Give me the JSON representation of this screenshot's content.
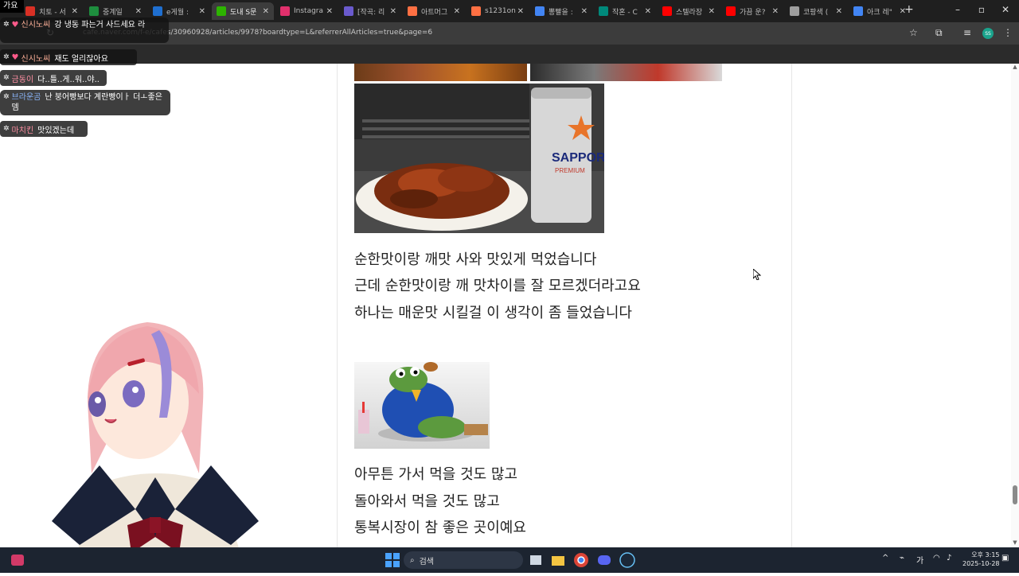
{
  "browser": {
    "tabs": [
      {
        "label": "치토 - 서",
        "favicon_color": "#d93025"
      },
      {
        "label": "중계일",
        "favicon_color": "#1e8e3e"
      },
      {
        "label": "e게월 :",
        "favicon_color": "#1f6fd0"
      },
      {
        "label": "도내 S문",
        "favicon_color": "#2db400",
        "active": true
      },
      {
        "label": "Instagra",
        "favicon_color": "#e1306c"
      },
      {
        "label": "[작곡: 리",
        "favicon_color": "#6a5acd"
      },
      {
        "label": "아트머그",
        "favicon_color": "#ff7043"
      },
      {
        "label": "s1231on",
        "favicon_color": "#ff7043"
      },
      {
        "label": "뽕빨을 :",
        "favicon_color": "#4285f4"
      },
      {
        "label": "작혼 - C",
        "favicon_color": "#00897b"
      },
      {
        "label": "스텔라장",
        "favicon_color": "#ff0000"
      },
      {
        "label": "가끔 운?",
        "favicon_color": "#ff0000"
      },
      {
        "label": "코팡색 (",
        "favicon_color": "#9e9e9e"
      },
      {
        "label": "아크 레\"",
        "favicon_color": "#4285f4"
      }
    ],
    "new_tab_label": "+",
    "url": "cafe.naver.com/f-e/cafes/30960928/articles/9978?boardtype=L&referrerAllArticles=true&page=6",
    "profile_initials": "SS"
  },
  "stream_overlay": {
    "top_label": "가요",
    "chat": [
      {
        "nick": "신시노씨",
        "nick_color": "#ffb199",
        "message": "강 냉동 파는거 사드세요 라",
        "badge": true
      },
      {
        "nick": "신시노씨",
        "nick_color": "#ffb199",
        "message": "재도 얼리잖아요",
        "badge": true
      },
      {
        "nick": "금동이",
        "nick_color": "#ff8fa3",
        "message": "다..틀..게..워..야..",
        "badge": false
      },
      {
        "nick": "브라운곰",
        "nick_color": "#8ab4f8",
        "message": "난 붕어빵보다 계란빵이ㅏ 더ㅗ좋은뎀",
        "badge": false
      },
      {
        "nick": "마치킨",
        "nick_color": "#ff8fa3",
        "message": "맛있겠는데",
        "badge": false
      }
    ]
  },
  "article": {
    "paragraph1": [
      "순한맛이랑 깨맛 사와 맛있게 먹었습니다",
      "근데 순한맛이랑 깨 맛차이를 잘 모르겠더라고요",
      "하나는 매운맛 시킬걸 이 생각이 좀 들었습니다"
    ],
    "paragraph2": [
      "아무튼 가서 먹을 것도 많고",
      "돌아와서 먹을 것도 많고",
      "통복시장이 참 좋은 곳이예요"
    ],
    "photo": {
      "can_brand": "SAPPORO",
      "can_sub": "PREMIUM",
      "icon": "food-photo-icon"
    },
    "sticker": {
      "icon": "frog-sticker-icon"
    }
  },
  "taskbar": {
    "search_placeholder": "검색",
    "ime": "가",
    "time": "오후 3:15",
    "date": "2025-10-28"
  }
}
